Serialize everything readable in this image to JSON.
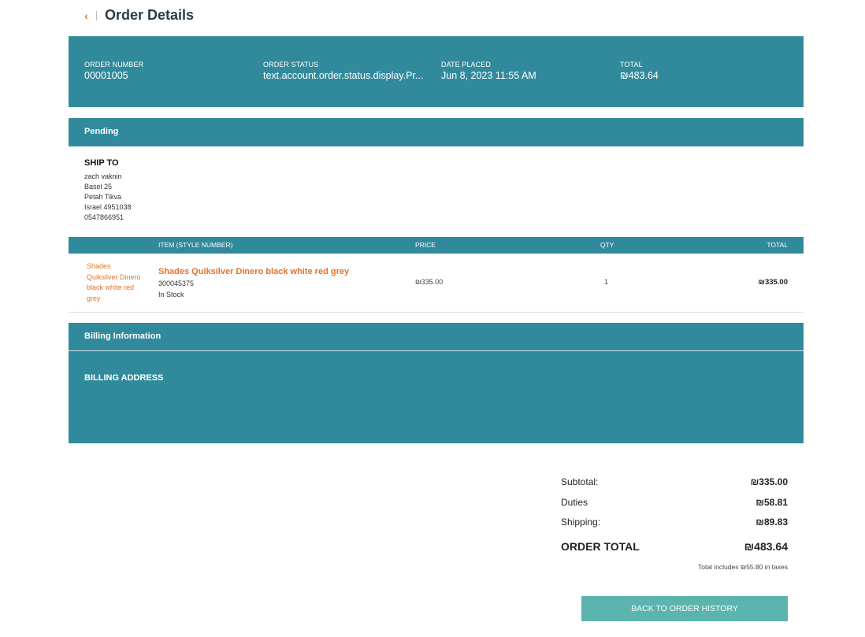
{
  "header": {
    "title": "Order Details",
    "back_icon": "chevron-left-icon"
  },
  "summary": {
    "order_number_label": "ORDER NUMBER",
    "order_number": "00001005",
    "order_status_label": "ORDER STATUS",
    "order_status": "text.account.order.status.display.Pr...",
    "date_placed_label": "DATE PLACED",
    "date_placed": "Jun 8, 2023 11:55 AM",
    "total_label": "TOTAL",
    "total": "₪483.64"
  },
  "status": "Pending",
  "ship_to": {
    "title": "SHIP TO",
    "lines": [
      "zach vaknin",
      "Basel 25",
      "Petah Tikva",
      "Israel 4951038",
      "0547866951"
    ]
  },
  "items_table": {
    "headers": {
      "item": "ITEM (STYLE NUMBER)",
      "price": "PRICE",
      "qty": "QTY",
      "total": "TOTAL"
    },
    "rows": [
      {
        "image_alt": "Shades Quiksilver Dinero black white red grey",
        "name": "Shades Quiksilver Dinero black white red grey",
        "style_number": "300045375",
        "stock": "In Stock",
        "price": "₪335.00",
        "qty": "1",
        "total": "₪335.00"
      }
    ]
  },
  "billing": {
    "title": "Billing Information",
    "address_label": "BILLING ADDRESS"
  },
  "totals": {
    "subtotal_label": "Subtotal:",
    "subtotal": "₪335.00",
    "duties_label": "Duties",
    "duties": "₪58.81",
    "shipping_label": "Shipping:",
    "shipping": "₪89.83",
    "order_total_label": "ORDER TOTAL",
    "order_total": "₪483.64",
    "tax_note": "Total includes ₪55.80 in taxes"
  },
  "back_button": "BACK TO ORDER HISTORY",
  "colors": {
    "teal": "#318a9c",
    "accent": "#e0742e",
    "button": "#5bb5ae"
  }
}
